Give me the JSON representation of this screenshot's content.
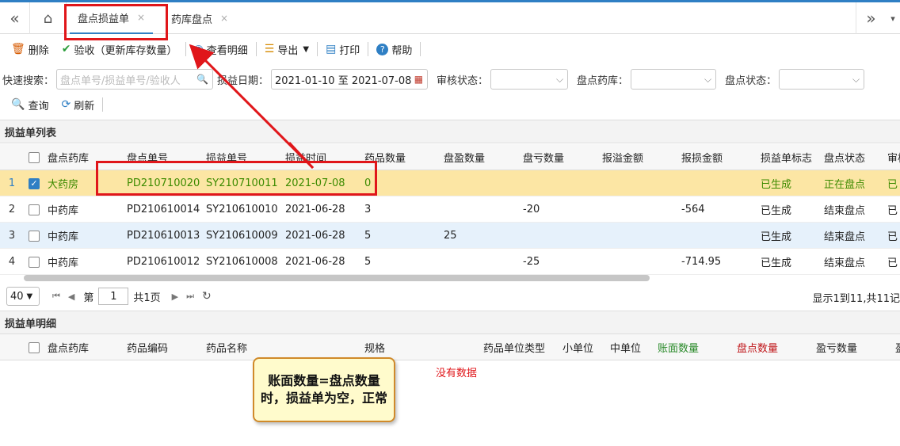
{
  "tabs": [
    {
      "label": "盘点损益单",
      "close": "×"
    },
    {
      "label": "药库盘点",
      "close": "×"
    }
  ],
  "toolbar": {
    "delete": "删除",
    "verify": "验收（更新库存数量）",
    "view_detail": "查看明细",
    "export": "导出",
    "print": "打印",
    "help": "帮助"
  },
  "search": {
    "quick_label": "快速搜索：",
    "quick_placeholder": "盘点单号/损益单号/验收人",
    "date_label": "损益日期：",
    "date_value": "2021-01-10 至 2021-07-08",
    "audit_label": "审核状态：",
    "pharmacy_label": "盘点药库：",
    "status_label": "盘点状态：",
    "query": "查询",
    "refresh": "刷新"
  },
  "list_title": "损益单列表",
  "list": {
    "headers": [
      "盘点药库",
      "盘点单号",
      "损益单号",
      "损益时间",
      "药品数量",
      "盘盈数量",
      "盘亏数量",
      "报溢金额",
      "报损金额",
      "损益单标志",
      "盘点状态",
      "审核"
    ],
    "rows": [
      {
        "n": "1",
        "c": [
          "大药房",
          "PD210710020",
          "SY210710011",
          "2021-07-08",
          "0",
          "",
          "",
          "",
          "",
          "已生成",
          "正在盘点",
          "已"
        ]
      },
      {
        "n": "2",
        "c": [
          "中药库",
          "PD210610014",
          "SY210610010",
          "2021-06-28",
          "3",
          "",
          "-20",
          "",
          "-564",
          "已生成",
          "结束盘点",
          "已"
        ]
      },
      {
        "n": "3",
        "c": [
          "中药库",
          "PD210610013",
          "SY210610009",
          "2021-06-28",
          "5",
          "25",
          "",
          "",
          "",
          "已生成",
          "结束盘点",
          "已"
        ]
      },
      {
        "n": "4",
        "c": [
          "中药库",
          "PD210610012",
          "SY210610008",
          "2021-06-28",
          "5",
          "",
          "-25",
          "",
          "-714.95",
          "已生成",
          "结束盘点",
          "已"
        ]
      }
    ]
  },
  "pager": {
    "page_size": "40",
    "page_prefix": "第",
    "page_value": "1",
    "page_suffix": "共1页",
    "summary": "显示1到11,共11记"
  },
  "detail_title": "损益单明细",
  "detail": {
    "headers": [
      "盘点药库",
      "药品编码",
      "药品名称",
      "规格",
      "药品单位类型",
      "小单位",
      "中单位",
      "账面数量",
      "盘点数量",
      "盈亏数量",
      "盈"
    ],
    "no_data": "没有数据"
  },
  "annotation": "账面数量=盘点数量时，损益单为空，正常",
  "colors": {
    "accent": "#2f7fc4",
    "annotation_red": "#e0161a",
    "selected_row": "#fce6a4",
    "green_text": "#3d8b00"
  }
}
